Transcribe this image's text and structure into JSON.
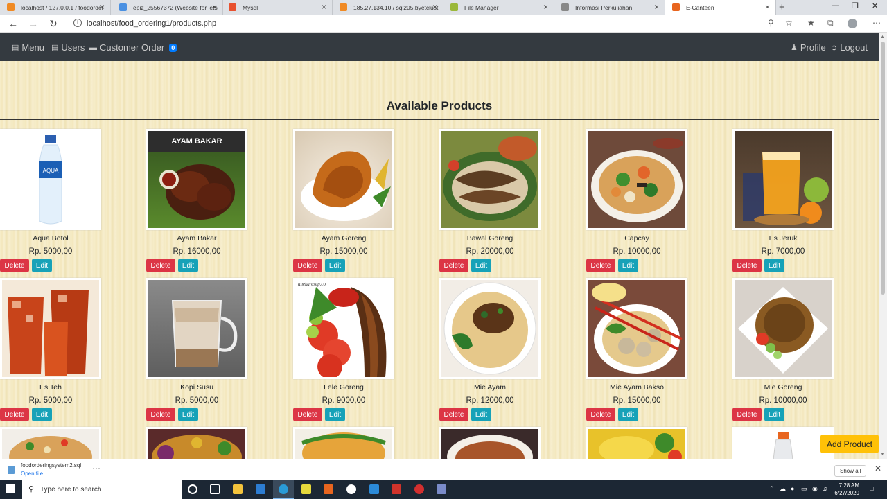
{
  "browser": {
    "tabs": [
      {
        "title": "localhost / 127.0.0.1 / foodorder",
        "color": "#f08a24",
        "active": false
      },
      {
        "title": "epiz_25567372 (Website for lets",
        "color": "#4a90e2",
        "active": false
      },
      {
        "title": "Mysql",
        "color": "#e8512f",
        "active": false
      },
      {
        "title": "185.27.134.10 / sql205.byetclust",
        "color": "#f08a24",
        "active": false
      },
      {
        "title": "File Manager",
        "color": "#9bb83a",
        "active": false
      },
      {
        "title": "Informasi Perkuliahan",
        "color": "#888888",
        "active": false
      },
      {
        "title": "E-Canteen",
        "color": "#e8651f",
        "active": true
      }
    ],
    "url": "localhost/food_ordering1/products.php"
  },
  "nav": {
    "menu": "Menu",
    "users": "Users",
    "customer_order": "Customer Order",
    "order_count": "0",
    "profile": "Profile",
    "logout": "Logout"
  },
  "page": {
    "heading": "Available Products",
    "add_product": "Add Product",
    "delete_label": "Delete",
    "edit_label": "Edit"
  },
  "products": [
    {
      "name": "Aqua Botol",
      "price": "Rp. 5000,00",
      "img": "bottle"
    },
    {
      "name": "Ayam Bakar",
      "price": "Rp. 16000,00",
      "img": "ayambakar",
      "img_text": "AYAM BAKAR"
    },
    {
      "name": "Ayam Goreng",
      "price": "Rp. 15000,00",
      "img": "friedchicken"
    },
    {
      "name": "Bawal Goreng",
      "price": "Rp. 20000,00",
      "img": "fish"
    },
    {
      "name": "Capcay",
      "price": "Rp. 10000,00",
      "img": "capcay"
    },
    {
      "name": "Es Jeruk",
      "price": "Rp. 7000,00",
      "img": "orange"
    },
    {
      "name": "Es Teh",
      "price": "Rp. 5000,00",
      "img": "icetea"
    },
    {
      "name": "Kopi Susu",
      "price": "Rp. 5000,00",
      "img": "coffee"
    },
    {
      "name": "Lele Goreng",
      "price": "Rp. 9000,00",
      "img": "lele",
      "img_text": "anekaresep.co"
    },
    {
      "name": "Mie Ayam",
      "price": "Rp. 12000,00",
      "img": "mieayam"
    },
    {
      "name": "Mie Ayam Bakso",
      "price": "Rp. 15000,00",
      "img": "bakso"
    },
    {
      "name": "Mie Goreng",
      "price": "Rp. 10000,00",
      "img": "miegoreng"
    }
  ],
  "partial_row": [
    "nasigoreng",
    "salad",
    "rice",
    "soup",
    "yellow",
    "bottle2"
  ],
  "downloads": {
    "file": "foodorderingsystem2.sql",
    "open": "Open file",
    "show_all": "Show all"
  },
  "taskbar": {
    "search_placeholder": "Type here to search",
    "time": "7:28 AM",
    "date": "6/27/2020"
  }
}
